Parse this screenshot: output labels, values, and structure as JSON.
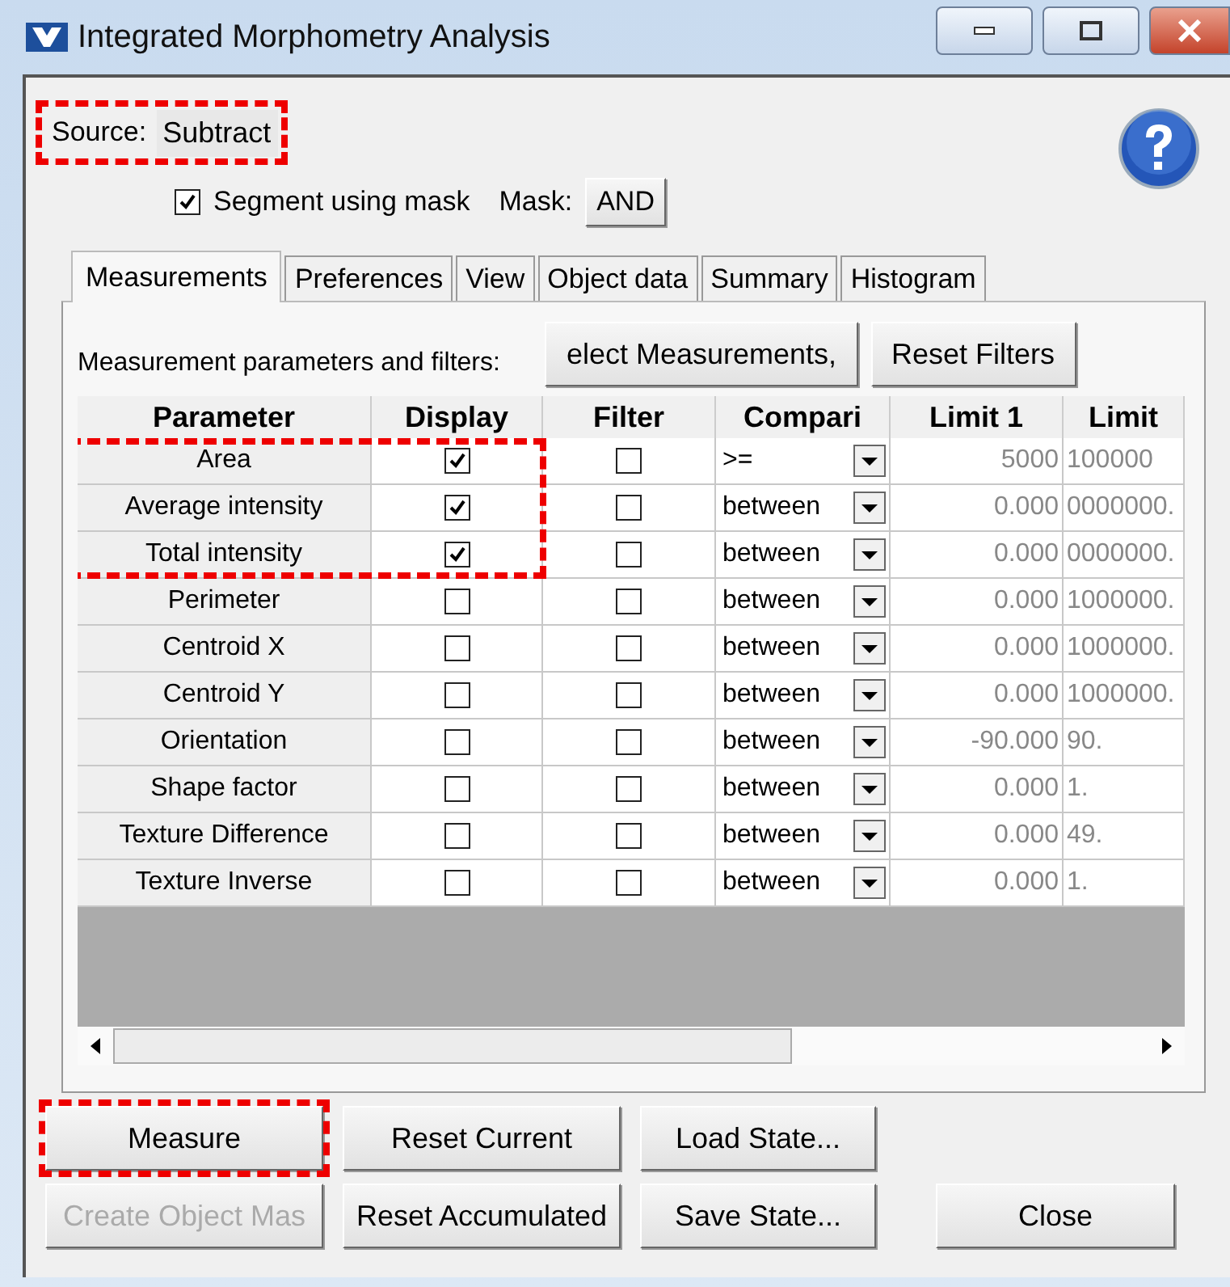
{
  "window": {
    "title": "Integrated Morphometry Analysis"
  },
  "source": {
    "label": "Source:",
    "value": "Subtract",
    "highlighted": true
  },
  "segment": {
    "label": "Segment using mask",
    "checked": true
  },
  "mask": {
    "label": "Mask:",
    "value": "AND"
  },
  "tabs": [
    {
      "label": "Measurements",
      "selected": true
    },
    {
      "label": "Preferences",
      "selected": false
    },
    {
      "label": "View",
      "selected": false
    },
    {
      "label": "Object data",
      "selected": false
    },
    {
      "label": "Summary",
      "selected": false
    },
    {
      "label": "Histogram",
      "selected": false
    }
  ],
  "panel": {
    "caption": "Measurement parameters and filters:",
    "buttons": [
      "elect Measurements,",
      "Reset Filters"
    ]
  },
  "table": {
    "columns": [
      "Parameter",
      "Display",
      "Filter",
      "Compari",
      "Limit 1",
      "Limit"
    ],
    "rows": [
      {
        "parameter": "Area",
        "display": true,
        "filter": false,
        "comparison": ">=",
        "limit_1": "5000",
        "column_6": "100000",
        "highlighted": true
      },
      {
        "parameter": "Average intensity",
        "display": true,
        "filter": false,
        "comparison": "between",
        "limit_1": "0.000",
        "column_6": "0000000.",
        "highlighted": true
      },
      {
        "parameter": "Total intensity",
        "display": true,
        "filter": false,
        "comparison": "between",
        "limit_1": "0.000",
        "column_6": "0000000.",
        "highlighted": true
      },
      {
        "parameter": "Perimeter",
        "display": false,
        "filter": false,
        "comparison": "between",
        "limit_1": "0.000",
        "column_6": "1000000.",
        "highlighted": false
      },
      {
        "parameter": "Centroid X",
        "display": false,
        "filter": false,
        "comparison": "between",
        "limit_1": "0.000",
        "column_6": "1000000.",
        "highlighted": false
      },
      {
        "parameter": "Centroid Y",
        "display": false,
        "filter": false,
        "comparison": "between",
        "limit_1": "0.000",
        "column_6": "1000000.",
        "highlighted": false
      },
      {
        "parameter": "Orientation",
        "display": false,
        "filter": false,
        "comparison": "between",
        "limit_1": "-90.000",
        "column_6": "90.",
        "highlighted": false
      },
      {
        "parameter": "Shape factor",
        "display": false,
        "filter": false,
        "comparison": "between",
        "limit_1": "0.000",
        "column_6": "1.",
        "highlighted": false
      },
      {
        "parameter": "Texture Difference",
        "display": false,
        "filter": false,
        "comparison": "between",
        "limit_1": "0.000",
        "column_6": "49.",
        "highlighted": false
      },
      {
        "parameter": "Texture Inverse",
        "display": false,
        "filter": false,
        "comparison": "between",
        "limit_1": "0.000",
        "column_6": "1.",
        "highlighted": false
      }
    ]
  },
  "buttons": [
    [
      {
        "label": "Measure",
        "disabled": false,
        "highlighted": true
      },
      {
        "label": "Reset Current",
        "disabled": false,
        "highlighted": false
      },
      {
        "label": "Load State...",
        "disabled": false,
        "highlighted": false
      }
    ],
    [
      {
        "label": "Create Object Mas",
        "disabled": true,
        "highlighted": false
      },
      {
        "label": "Reset Accumulated",
        "disabled": false,
        "highlighted": false
      },
      {
        "label": "Save State...",
        "disabled": false,
        "highlighted": false
      },
      {
        "label": "Close",
        "disabled": false,
        "highlighted": false
      }
    ]
  ]
}
